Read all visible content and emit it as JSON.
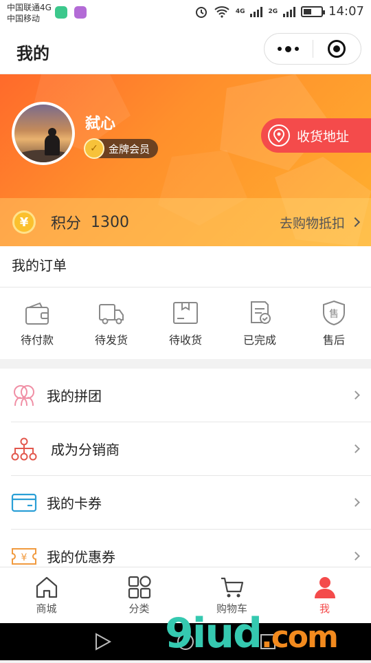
{
  "status_bar": {
    "carrier1": "中国联通4G",
    "carrier2": "中国移动",
    "net1": "4G",
    "net2": "2G",
    "time": "14:07"
  },
  "header": {
    "title": "我的"
  },
  "profile": {
    "username": "弑心",
    "member_level": "金牌会员",
    "address_button": "收货地址",
    "points_label": "积分",
    "points_value": "1300",
    "points_link": "去购物抵扣",
    "bg_color_start": "#ff6a2b",
    "bg_color_end": "#ffb12f",
    "accent": "#f44b4b"
  },
  "orders": {
    "title": "我的订单",
    "items": [
      {
        "label": "待付款",
        "icon": "wallet-icon"
      },
      {
        "label": "待发货",
        "icon": "truck-icon"
      },
      {
        "label": "待收货",
        "icon": "package-icon"
      },
      {
        "label": "已完成",
        "icon": "completed-icon"
      },
      {
        "label": "售后",
        "icon": "after-sales-icon"
      }
    ]
  },
  "menu": {
    "items": [
      {
        "label": "我的拼团",
        "icon": "group-buy-icon"
      },
      {
        "label": "成为分销商",
        "icon": "distributor-icon"
      },
      {
        "label": "我的卡券",
        "icon": "card-icon"
      },
      {
        "label": "我的优惠券",
        "icon": "coupon-icon"
      }
    ]
  },
  "tabbar": {
    "items": [
      {
        "label": "商城",
        "icon": "home-icon"
      },
      {
        "label": "分类",
        "icon": "category-icon"
      },
      {
        "label": "购物车",
        "icon": "cart-icon"
      },
      {
        "label": "我",
        "icon": "profile-icon",
        "active": true
      }
    ]
  },
  "watermark": {
    "text": "9iud",
    "suffix": ".com"
  }
}
